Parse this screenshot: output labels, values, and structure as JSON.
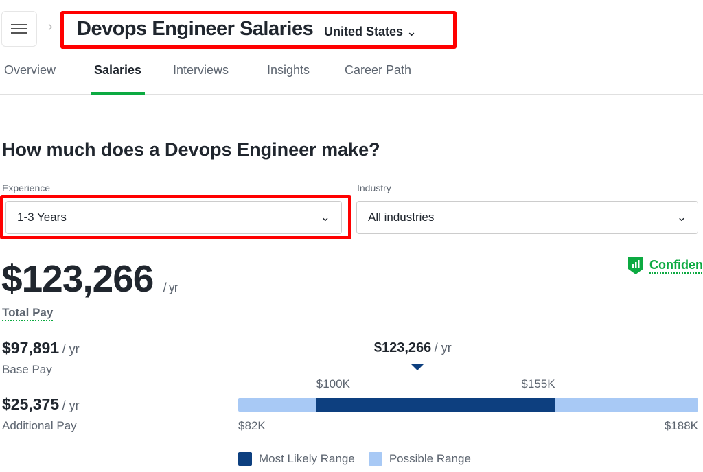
{
  "header": {
    "title": "Devops Engineer Salaries",
    "country": "United States"
  },
  "tabs": [
    {
      "label": "Overview"
    },
    {
      "label": "Salaries",
      "active": true
    },
    {
      "label": "Interviews"
    },
    {
      "label": "Insights"
    },
    {
      "label": "Career Path"
    }
  ],
  "main": {
    "heading": "How much does a Devops Engineer make?",
    "experience": {
      "label": "Experience",
      "value": "1-3 Years"
    },
    "industry": {
      "label": "Industry",
      "value": "All industries"
    },
    "total": {
      "amount": "$123,266",
      "unit": "/ yr",
      "label": "Total Pay"
    },
    "confidence": "Confident",
    "base": {
      "amount": "$97,891",
      "unit": "/ yr",
      "label": "Base Pay"
    },
    "additional": {
      "amount": "$25,375",
      "unit": "/ yr",
      "label": "Additional Pay"
    },
    "range": {
      "median_label": "$123,266",
      "median_unit": "/ yr",
      "low_likely": "$100K",
      "high_likely": "$155K",
      "min": "$82K",
      "max": "$188K",
      "values": {
        "min": 82,
        "likely_low": 100,
        "median": 123.266,
        "likely_high": 155,
        "max": 188
      }
    },
    "legend": {
      "likely": "Most Likely Range",
      "possible": "Possible Range"
    }
  },
  "colors": {
    "accent": "#0caa41",
    "likely": "#0d3f7f",
    "possible": "#a8c9f5",
    "highlight": "#ff0000"
  }
}
